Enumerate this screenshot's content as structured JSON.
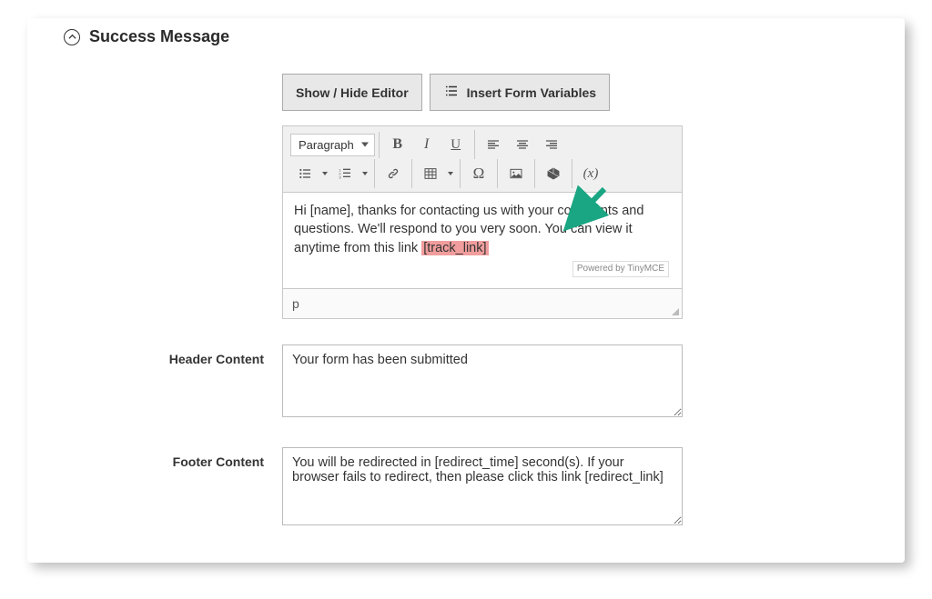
{
  "section": {
    "title": "Success Message"
  },
  "buttons": {
    "toggle_editor": "Show / Hide Editor",
    "insert_vars": "Insert Form Variables"
  },
  "editor": {
    "format_select": "Paragraph",
    "body_pre": "Hi [name], thanks for contacting us with your comments and questions. We'll respond to you very soon. You can view it anytime from this link ",
    "body_highlight": "[track_link]",
    "powered": "Powered by TinyMCE",
    "path": "p"
  },
  "fields": {
    "header_label": "Header Content",
    "header_value": "Your form has been submitted",
    "footer_label": "Footer Content",
    "footer_value": "You will be redirected in [redirect_time] second(s). If your browser fails to redirect, then please click this link [redirect_link]"
  }
}
